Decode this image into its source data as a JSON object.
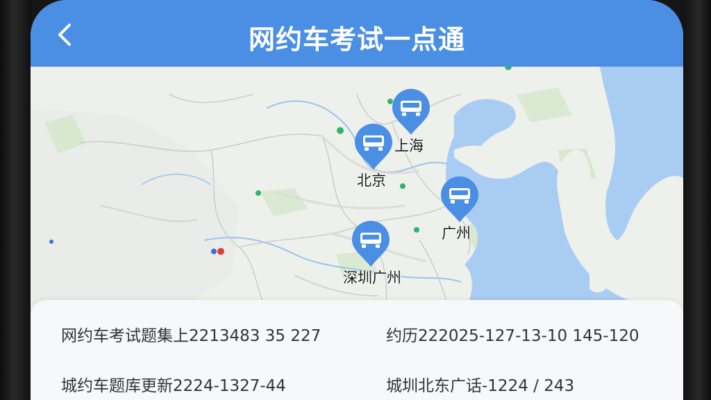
{
  "header": {
    "title": "网约车考试一点通",
    "back_icon": "chevron-left-icon",
    "background": "#4a8fe3"
  },
  "map": {
    "sea_color": "#a9cdf2",
    "land_color": "#eef0ec",
    "marker_color": "#4a8fe3",
    "marker_icon": "car-icon",
    "markers": [
      {
        "label": "上海"
      },
      {
        "label": "北京"
      },
      {
        "label": "广州"
      },
      {
        "label": "深圳广州"
      }
    ]
  },
  "info": {
    "row1_left": "网约车考试题集上2213483 35 227",
    "row1_right": "约历222025-127-13-10 145-120",
    "row2_left": "城约车题库更新2224-1327-44",
    "row2_right": "城圳北东广话-1224 / 243"
  }
}
